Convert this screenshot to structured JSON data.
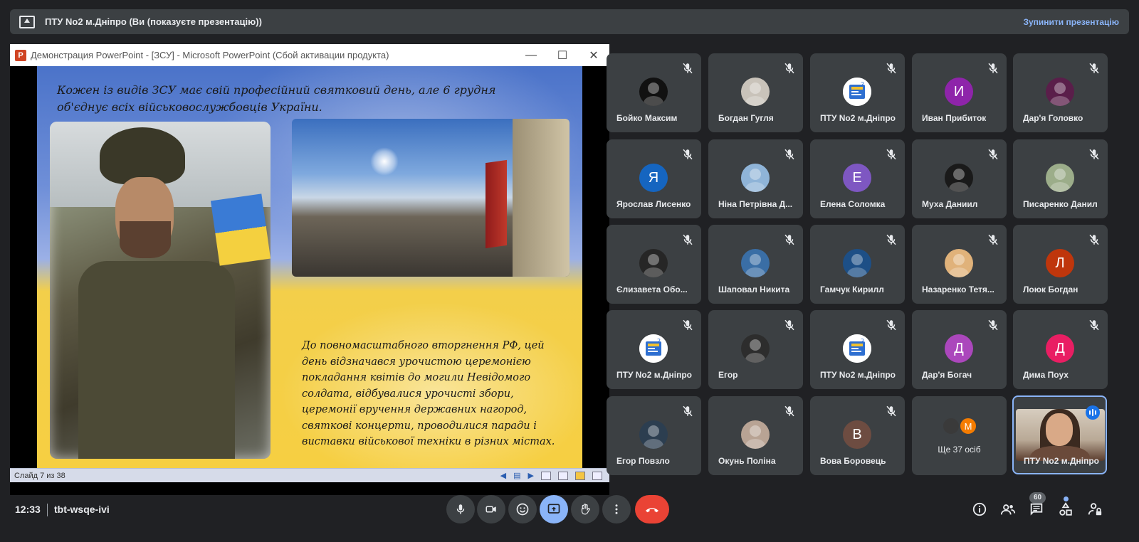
{
  "presenting_bar": {
    "title": "ПТУ No2 м.Дніпро (Ви (показуєте презентацію))",
    "stop_label": "Зупинити презентацію"
  },
  "powerpoint": {
    "window_title": "Демонстрация PowerPoint - [ЗСУ] - Microsoft PowerPoint (Сбой активации продукта)",
    "logo_letter": "P",
    "slide_text_top": "Кожен із видів ЗСУ має свій професійний святковий день, але 6 грудня об'єднує всіх військовослужбовців України.",
    "slide_text_bottom": "До повномасштабного вторгнення РФ, цей день відзначався урочистою церемонією покладання квітів до могили Невідомого солдата, відбувалися урочисті збори, церемонії вручення державних нагород, святкові концерти, проводилися паради і виставки військової техніки в різних містах.",
    "status_slide": "Слайд 7 из 38"
  },
  "participants": [
    {
      "name": "Бойко Максим",
      "avatar_type": "photo",
      "avatar_color": "#111111",
      "initial": ""
    },
    {
      "name": "Богдан Гугля",
      "avatar_type": "photo",
      "avatar_color": "#c9c3ba",
      "initial": ""
    },
    {
      "name": "ПТУ No2 м.Дніпро",
      "avatar_type": "logo",
      "avatar_color": "#ffffff",
      "initial": ""
    },
    {
      "name": "Иван Прибиток",
      "avatar_type": "letter",
      "avatar_color": "#8e24aa",
      "initial": "И"
    },
    {
      "name": "Дар'я Головко",
      "avatar_type": "photo",
      "avatar_color": "#5a1e4a",
      "initial": ""
    },
    {
      "name": "Ярослав Лисенко",
      "avatar_type": "letter",
      "avatar_color": "#1565c0",
      "initial": "Я"
    },
    {
      "name": "Ніна Петрівна Д...",
      "avatar_type": "photo",
      "avatar_color": "#8fb4d8",
      "initial": ""
    },
    {
      "name": "Елена Соломка",
      "avatar_type": "letter",
      "avatar_color": "#7e57c2",
      "initial": "Е"
    },
    {
      "name": "Муха Даниил",
      "avatar_type": "photo",
      "avatar_color": "#1a1a1a",
      "initial": ""
    },
    {
      "name": "Писаренко Данил",
      "avatar_type": "photo",
      "avatar_color": "#9cad8a",
      "initial": ""
    },
    {
      "name": "Єлизавета Обо...",
      "avatar_type": "photo",
      "avatar_color": "#262626",
      "initial": ""
    },
    {
      "name": "Шаповал Никита",
      "avatar_type": "photo",
      "avatar_color": "#3a6ea5",
      "initial": ""
    },
    {
      "name": "Гамчук Кирилл",
      "avatar_type": "photo",
      "avatar_color": "#1d4f86",
      "initial": ""
    },
    {
      "name": "Назаренко Тетя...",
      "avatar_type": "photo",
      "avatar_color": "#e0b27a",
      "initial": ""
    },
    {
      "name": "Лоюк Богдан",
      "avatar_type": "letter",
      "avatar_color": "#bf360c",
      "initial": "Л"
    },
    {
      "name": "ПТУ No2 м.Дніпро",
      "avatar_type": "logo",
      "avatar_color": "#ffffff",
      "initial": ""
    },
    {
      "name": "Егор",
      "avatar_type": "photo",
      "avatar_color": "#2d2d2d",
      "initial": ""
    },
    {
      "name": "ПТУ No2 м.Дніпро",
      "avatar_type": "logo",
      "avatar_color": "#ffffff",
      "initial": ""
    },
    {
      "name": "Дар'я Богач",
      "avatar_type": "letter",
      "avatar_color": "#ab47bc",
      "initial": "Д"
    },
    {
      "name": "Дима Поух",
      "avatar_type": "letter",
      "avatar_color": "#e91e63",
      "initial": "Д"
    },
    {
      "name": "Егор Повзло",
      "avatar_type": "photo",
      "avatar_color": "#2c3e50",
      "initial": ""
    },
    {
      "name": "Окунь Поліна",
      "avatar_type": "photo",
      "avatar_color": "#b8a394",
      "initial": ""
    },
    {
      "name": "Вова Боровець",
      "avatar_type": "letter",
      "avatar_color": "#6d4c41",
      "initial": "В"
    }
  ],
  "more_tile": {
    "label": "Ще 37 осіб",
    "avatar2_initial": "М",
    "avatar1_color": "#3a3a3a",
    "avatar2_color": "#f57c00"
  },
  "active_speaker": {
    "name": "ПТУ No2 м.Дніпро"
  },
  "bottom_bar": {
    "time": "12:33",
    "meeting_code": "tbt-wsqe-ivi",
    "participants_count": "60"
  },
  "colors": {
    "background": "#202124",
    "tile": "#3c4043",
    "accent": "#8ab4f8",
    "end_call": "#ea4335"
  }
}
